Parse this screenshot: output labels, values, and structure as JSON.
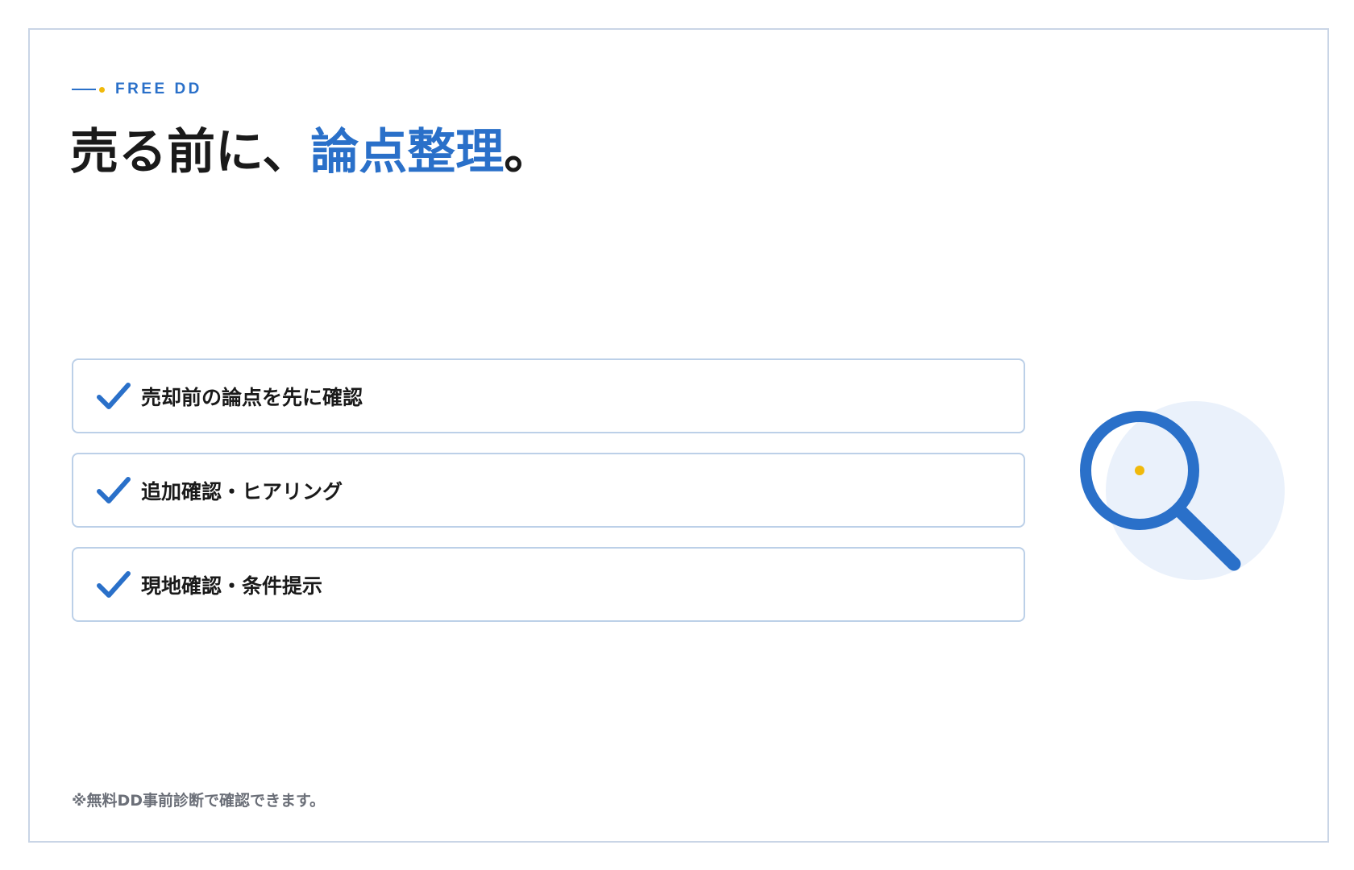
{
  "colors": {
    "accent": "#2a70c9",
    "dot": "#f0b90b",
    "text": "#1a1a1a",
    "muted": "#6b6f78",
    "border": "#bcd0e8",
    "halo": "#eaf1fb"
  },
  "header": {
    "eyebrow": "FREE DD",
    "title_prefix": "売る前に、",
    "title_highlight": "論点整理",
    "title_suffix": "。"
  },
  "checklist": {
    "items": [
      {
        "icon": "check-icon",
        "label": "売却前の論点を先に確認"
      },
      {
        "icon": "check-icon",
        "label": "追加確認・ヒアリング"
      },
      {
        "icon": "check-icon",
        "label": "現地確認・条件提示"
      }
    ]
  },
  "illustration": {
    "icon": "magnifier-icon"
  },
  "footer": {
    "note": "※無料DD事前診断で確認できます。"
  }
}
